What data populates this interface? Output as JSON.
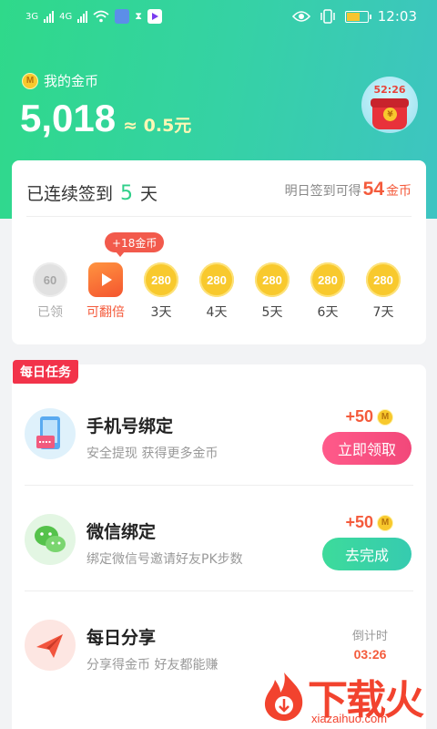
{
  "status_bar": {
    "network_1": "3G",
    "network_2": "4G",
    "time": "12:03",
    "battery_level": 0.6
  },
  "wallet": {
    "label": "我的金币",
    "coin_badge": "M",
    "balance": "5,018",
    "equivalent": "≈ 0.5元"
  },
  "red_packet": {
    "timer": "52:26",
    "coin_symbol": "¥"
  },
  "signin": {
    "prefix": "已连续签到",
    "days": "5",
    "suffix": "天",
    "tomorrow_prefix": "明日签到可得",
    "tomorrow_amount": "54",
    "tomorrow_unit": "金币",
    "bonus_bubble": "+18金币",
    "days_list": [
      {
        "value": "60",
        "label": "已领",
        "state": "done"
      },
      {
        "value": "",
        "label": "可翻倍",
        "state": "video"
      },
      {
        "value": "280",
        "label": "3天",
        "state": "pending"
      },
      {
        "value": "280",
        "label": "4天",
        "state": "pending"
      },
      {
        "value": "280",
        "label": "5天",
        "state": "pending"
      },
      {
        "value": "280",
        "label": "6天",
        "state": "pending"
      },
      {
        "value": "280",
        "label": "7天",
        "state": "pending"
      }
    ]
  },
  "daily_tasks": {
    "tag": "每日任务",
    "items": [
      {
        "name": "手机号绑定",
        "desc": "安全提现 获得更多金币",
        "reward": "+50",
        "coin": "M",
        "button": "立即领取",
        "icon": "phone-icon"
      },
      {
        "name": "微信绑定",
        "desc": "绑定微信号邀请好友PK步数",
        "reward": "+50",
        "coin": "M",
        "button": "去完成",
        "icon": "wechat-icon"
      },
      {
        "name": "每日分享",
        "desc": "分享得金币 好友都能赚",
        "countdown_label": "倒计时",
        "countdown_time": "03:26",
        "icon": "paper-plane-icon"
      }
    ]
  },
  "watermark": {
    "text": "下载火",
    "url": "xiazaihuo.com"
  },
  "colors": {
    "brand_green": "#2fd98a",
    "accent_red": "#f45b3c",
    "coin_gold": "#f8c92d"
  }
}
